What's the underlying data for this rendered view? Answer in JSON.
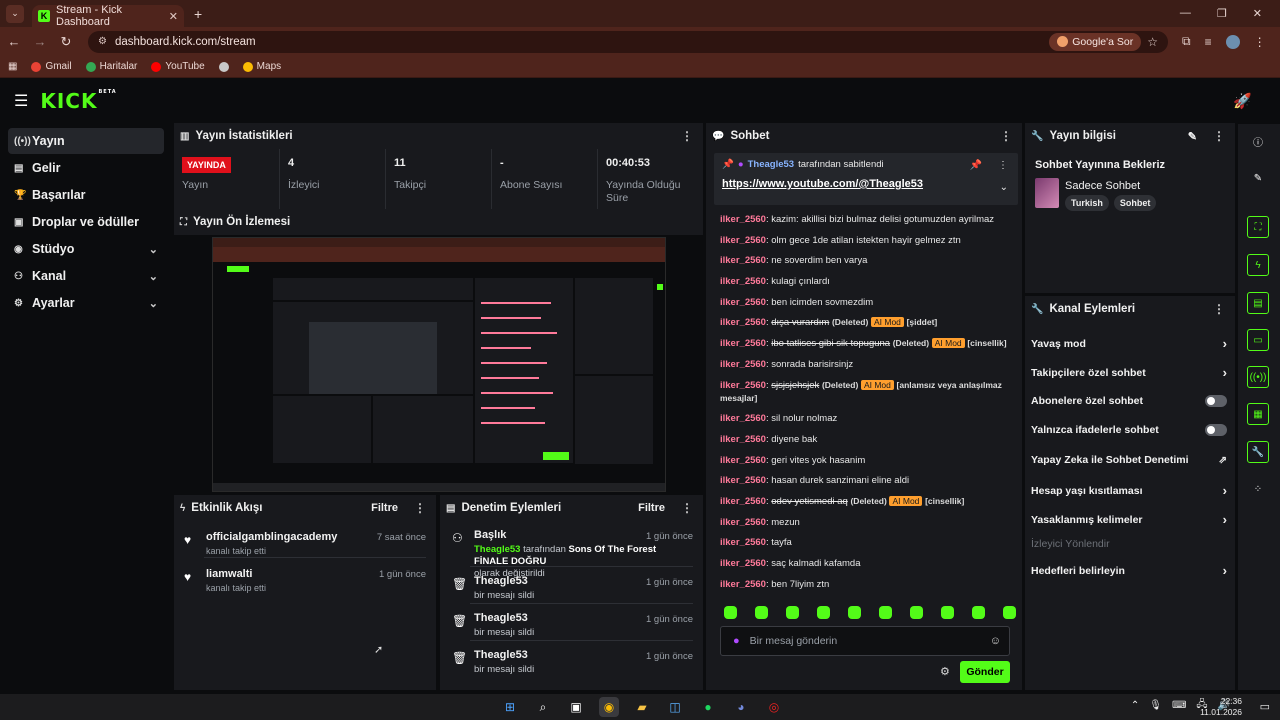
{
  "browser": {
    "tab_title": "Stream - Kick Dashboard",
    "url": "dashboard.kick.com/stream",
    "google_pill": "Google'a Sor",
    "bookmarks": [
      "Gmail",
      "Haritalar",
      "YouTube",
      "",
      "Maps"
    ]
  },
  "kick": {
    "logo": "KICK",
    "logo_sup": "BETA"
  },
  "sidebar": {
    "items": [
      {
        "label": "Yayın"
      },
      {
        "label": "Gelir"
      },
      {
        "label": "Başarılar"
      },
      {
        "label": "Droplar ve ödüller"
      },
      {
        "label": "Stüdyo"
      },
      {
        "label": "Kanal"
      },
      {
        "label": "Ayarlar"
      }
    ]
  },
  "stats": {
    "title": "Yayın İstatistikleri",
    "live_badge": "YAYINDA",
    "items": [
      {
        "value": "",
        "label": "Yayın"
      },
      {
        "value": "4",
        "label": "İzleyici"
      },
      {
        "value": "11",
        "label": "Takipçi"
      },
      {
        "value": "-",
        "label": "Abone Sayısı"
      },
      {
        "value": "00:40:53",
        "label": "Yayında Olduğu Süre"
      }
    ]
  },
  "preview": {
    "title": "Yayın Ön İzlemesi"
  },
  "activity": {
    "title": "Etkinlik Akışı",
    "filter": "Filtre",
    "items": [
      {
        "name": "officialgamblingacademy",
        "sub": "kanalı takip etti",
        "time": "7 saat önce"
      },
      {
        "name": "liamwalti",
        "sub": "kanalı takip etti",
        "time": "1 gün önce"
      }
    ]
  },
  "moderation": {
    "title": "Denetim Eylemleri",
    "filter": "Filtre",
    "first": {
      "name": "Başlık",
      "user": "Theagle53",
      "mid": "tarafından",
      "game": "Sons Of The Forest FİNALE DOĞRU",
      "end": "olarak değiştirildi",
      "time": "1 gün önce"
    },
    "items": [
      {
        "name": "Theagle53",
        "sub": "bir mesajı sildi",
        "time": "1 gün önce"
      },
      {
        "name": "Theagle53",
        "sub": "bir mesajı sildi",
        "time": "1 gün önce"
      },
      {
        "name": "Theagle53",
        "sub": "bir mesajı sildi",
        "time": "1 gün önce"
      }
    ]
  },
  "chat": {
    "title": "Sohbet",
    "pinned_user": "Theagle53",
    "pinned_by": "tarafından sabitlendi",
    "pinned_link": "https://www.youtube.com/@Theagle53",
    "input_placeholder": "Bir mesaj gönderin",
    "send": "Gönder",
    "messages": [
      {
        "user": "ilker_2560",
        "text": "kazim: akillisi bizi bulmaz delisi gotumuzden ayrilmaz"
      },
      {
        "user": "ilker_2560",
        "text": "olm gece 1de atilan istekten hayir gelmez ztn"
      },
      {
        "user": "ilker_2560",
        "text": "ne soverdim ben varya"
      },
      {
        "user": "ilker_2560",
        "text": "kulagi çınlardı"
      },
      {
        "user": "ilker_2560",
        "text": "ben icimden sovmezdim"
      },
      {
        "user": "ilker_2560",
        "text": "dışa vurardım",
        "deleted": "(Deleted)",
        "mod": "AI Mod",
        "reason": "[şiddet]"
      },
      {
        "user": "ilker_2560",
        "text": "ibo tatlises gibi sik topuguna",
        "deleted": "(Deleted)",
        "mod": "AI Mod",
        "reason": "[cinsellik]"
      },
      {
        "user": "ilker_2560",
        "text": "sonrada barisirsinjz"
      },
      {
        "user": "ilker_2560",
        "text": "sjsjsjehsjek",
        "deleted": "(Deleted)",
        "mod": "AI Mod",
        "reason": "[anlamsız veya anlaşılmaz mesajlar]"
      },
      {
        "user": "ilker_2560",
        "text": "sil nolur nolmaz"
      },
      {
        "user": "ilker_2560",
        "text": "diyene bak"
      },
      {
        "user": "ilker_2560",
        "text": "geri vites yok hasanim"
      },
      {
        "user": "ilker_2560",
        "text": "hasan durek sanzimani eline aldi"
      },
      {
        "user": "ilker_2560",
        "text": "odev yetismedi aq",
        "deleted": "(Deleted)",
        "mod": "AI Mod",
        "reason": "[cinsellik]"
      },
      {
        "user": "ilker_2560",
        "text": "mezun"
      },
      {
        "user": "ilker_2560",
        "text": "tayfa"
      },
      {
        "user": "ilker_2560",
        "text": "saç kalmadi kafamda"
      },
      {
        "user": "ilker_2560",
        "text": "ben 7liyim ztn"
      }
    ]
  },
  "info": {
    "title": "Yayın bilgisi",
    "stream_title": "Sohbet Yayınına Bekleriz",
    "category": "Sadece Sohbet",
    "tags": [
      "Turkish",
      "Sohbet"
    ]
  },
  "channel_actions": {
    "title": "Kanal Eylemleri",
    "items": [
      {
        "label": "Yavaş mod",
        "kind": "arrow"
      },
      {
        "label": "Takipçilere özel sohbet",
        "kind": "arrow"
      },
      {
        "label": "Abonelere özel sohbet",
        "kind": "toggle"
      },
      {
        "label": "Yalnızca ifadelerle sohbet",
        "kind": "toggle"
      },
      {
        "label": "Yapay Zeka ile Sohbet Denetimi",
        "kind": "external"
      },
      {
        "label": "Hesap yaşı kısıtlaması",
        "kind": "arrow"
      },
      {
        "label": "Yasaklanmış kelimeler",
        "kind": "arrow"
      },
      {
        "label": "İzleyici Yönlendir",
        "kind": "disabled"
      },
      {
        "label": "Hedefleri belirleyin",
        "kind": "arrow"
      }
    ]
  },
  "taskbar": {
    "time": "22:36",
    "date": "11.01.2026"
  },
  "colors": {
    "accent": "#53fc18",
    "live": "#e0101b",
    "chat_user": "#ff7a9a",
    "ai_mod": "#ff9f2e"
  }
}
